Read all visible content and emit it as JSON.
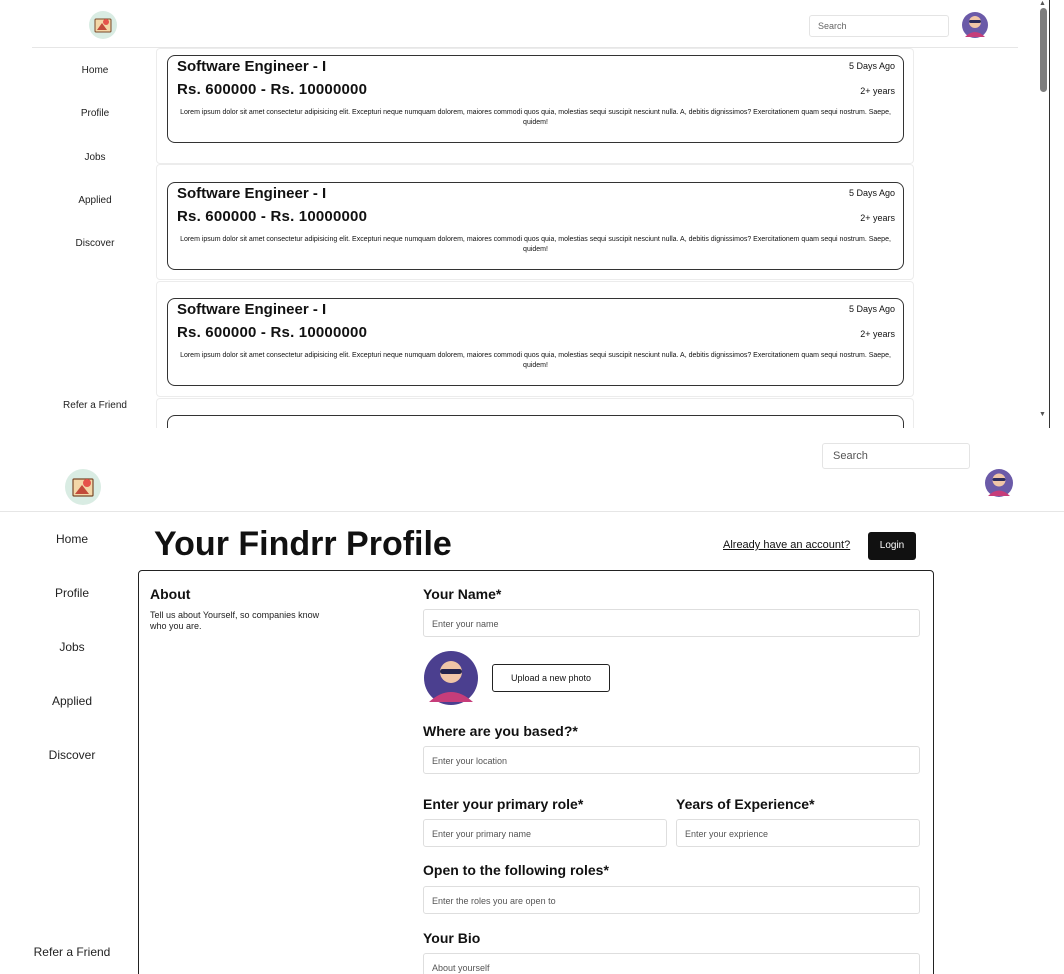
{
  "jobs_view": {
    "search": {
      "placeholder": "Search"
    },
    "nav": [
      {
        "label": "Home"
      },
      {
        "label": "Profile"
      },
      {
        "label": "Jobs"
      },
      {
        "label": "Applied"
      },
      {
        "label": "Discover"
      },
      {
        "label": "Refer a Friend"
      }
    ],
    "jobs": [
      {
        "title": "Software Engineer - I",
        "posted": "5 Days Ago",
        "salary": "Rs. 600000 - Rs. 10000000",
        "experience": "2+ years",
        "description": "Lorem ipsum dolor sit amet consectetur adipisicing elit. Excepturi neque numquam dolorem, maiores commodi quos quia, molestias sequi suscipit nesciunt nulla. A, debitis dignissimos? Exercitationem quam sequi nostrum. Saepe, quidem!"
      },
      {
        "title": "Software Engineer - I",
        "posted": "5 Days Ago",
        "salary": "Rs. 600000 - Rs. 10000000",
        "experience": "2+ years",
        "description": "Lorem ipsum dolor sit amet consectetur adipisicing elit. Excepturi neque numquam dolorem, maiores commodi quos quia, molestias sequi suscipit nesciunt nulla. A, debitis dignissimos? Exercitationem quam sequi nostrum. Saepe, quidem!"
      },
      {
        "title": "Software Engineer - I",
        "posted": "5 Days Ago",
        "salary": "Rs. 600000 - Rs. 10000000",
        "experience": "2+ years",
        "description": "Lorem ipsum dolor sit amet consectetur adipisicing elit. Excepturi neque numquam dolorem, maiores commodi quos quia, molestias sequi suscipit nesciunt nulla. A, debitis dignissimos? Exercitationem quam sequi nostrum. Saepe, quidem!"
      }
    ]
  },
  "profile_view": {
    "search": {
      "placeholder": "Search"
    },
    "nav": [
      {
        "label": "Home"
      },
      {
        "label": "Profile"
      },
      {
        "label": "Jobs"
      },
      {
        "label": "Applied"
      },
      {
        "label": "Discover"
      },
      {
        "label": "Refer a Friend"
      }
    ],
    "title": "Your Findrr Profile",
    "account_link": "Already have an account?",
    "login_label": "Login",
    "about": {
      "title": "About",
      "subtitle": "Tell us about Yourself, so companies know who you are."
    },
    "form": {
      "name_label": "Your Name*",
      "name_placeholder": "Enter your name",
      "upload_label": "Upload a new photo",
      "location_label": "Where are you based?*",
      "location_placeholder": "Enter your location",
      "role_label": "Enter your primary role*",
      "role_placeholder": "Enter your primary name",
      "experience_label": "Years of Experience*",
      "experience_placeholder": "Enter your exprience",
      "open_roles_label": "Open to the following roles*",
      "open_roles_placeholder": "Enter the roles you are open to",
      "bio_label": "Your Bio",
      "bio_placeholder": "About yourself"
    }
  }
}
